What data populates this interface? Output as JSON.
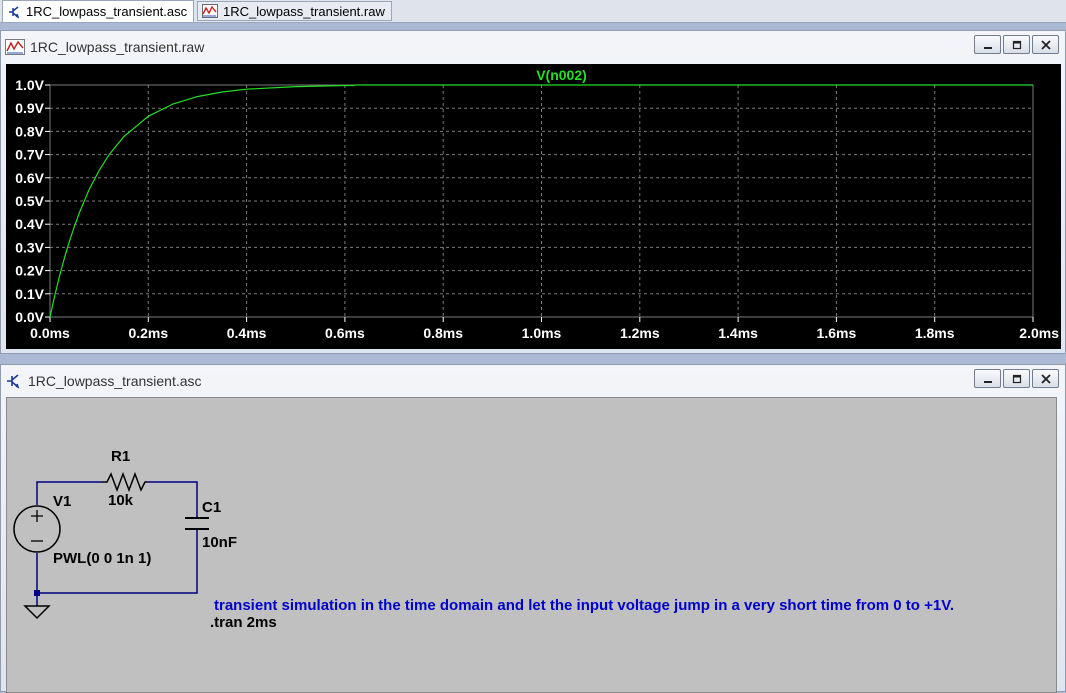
{
  "tabs": [
    {
      "label": "1RC_lowpass_transient.asc",
      "icon": "schematic-icon",
      "active": true
    },
    {
      "label": "1RC_lowpass_transient.raw",
      "icon": "waveform-icon",
      "active": false
    }
  ],
  "wave_window": {
    "title": "1RC_lowpass_transient.raw",
    "icon": "waveform-icon",
    "controls": [
      "minimize",
      "maximize",
      "close"
    ]
  },
  "schematic_window": {
    "title": "1RC_lowpass_transient.asc",
    "icon": "schematic-icon",
    "controls": [
      "minimize",
      "maximize",
      "close"
    ],
    "components": {
      "r1": {
        "name": "R1",
        "value": "10k"
      },
      "c1": {
        "name": "C1",
        "value": "10nF"
      },
      "v1": {
        "name": "V1",
        "value": "PWL(0 0 1n 1)"
      }
    },
    "comment": "transient simulation in the time domain and let the input voltage jump in a very short time from 0 to +1V.",
    "directive": ".tran 2ms"
  },
  "colors": {
    "trace": "#22e022",
    "trace_label": "#22e022",
    "plot_bg": "#000000",
    "axis_text": "#ffffff",
    "grid": "#7a7a7a",
    "schematic_bg": "#c0c0c0",
    "wire": "#000080",
    "comment": "#0000cc"
  },
  "chart_data": {
    "type": "line",
    "series": [
      {
        "name": "V(n002)",
        "x": [
          0,
          0.01,
          0.02,
          0.03,
          0.04,
          0.05,
          0.06,
          0.08,
          0.1,
          0.12,
          0.15,
          0.2,
          0.25,
          0.3,
          0.35,
          0.4,
          0.5,
          0.6,
          0.62
        ],
        "y": [
          0,
          0.095,
          0.181,
          0.259,
          0.33,
          0.393,
          0.451,
          0.551,
          0.632,
          0.699,
          0.777,
          0.865,
          0.918,
          0.95,
          0.97,
          0.982,
          0.993,
          0.998,
          0.998
        ]
      }
    ],
    "flat_segment": {
      "x": [
        0.62,
        2.0
      ],
      "y": [
        1.0,
        1.0
      ]
    },
    "x_ticks": [
      "0.0ms",
      "0.2ms",
      "0.4ms",
      "0.6ms",
      "0.8ms",
      "1.0ms",
      "1.2ms",
      "1.4ms",
      "1.6ms",
      "1.8ms",
      "2.0ms"
    ],
    "y_ticks": [
      "0.0V",
      "0.1V",
      "0.2V",
      "0.3V",
      "0.4V",
      "0.5V",
      "0.6V",
      "0.7V",
      "0.8V",
      "0.9V",
      "1.0V"
    ],
    "xlim": [
      0,
      2.0
    ],
    "ylim": [
      0,
      1.0
    ],
    "x_unit": "ms",
    "y_unit": "V",
    "grid": true,
    "legend": "top-center"
  }
}
